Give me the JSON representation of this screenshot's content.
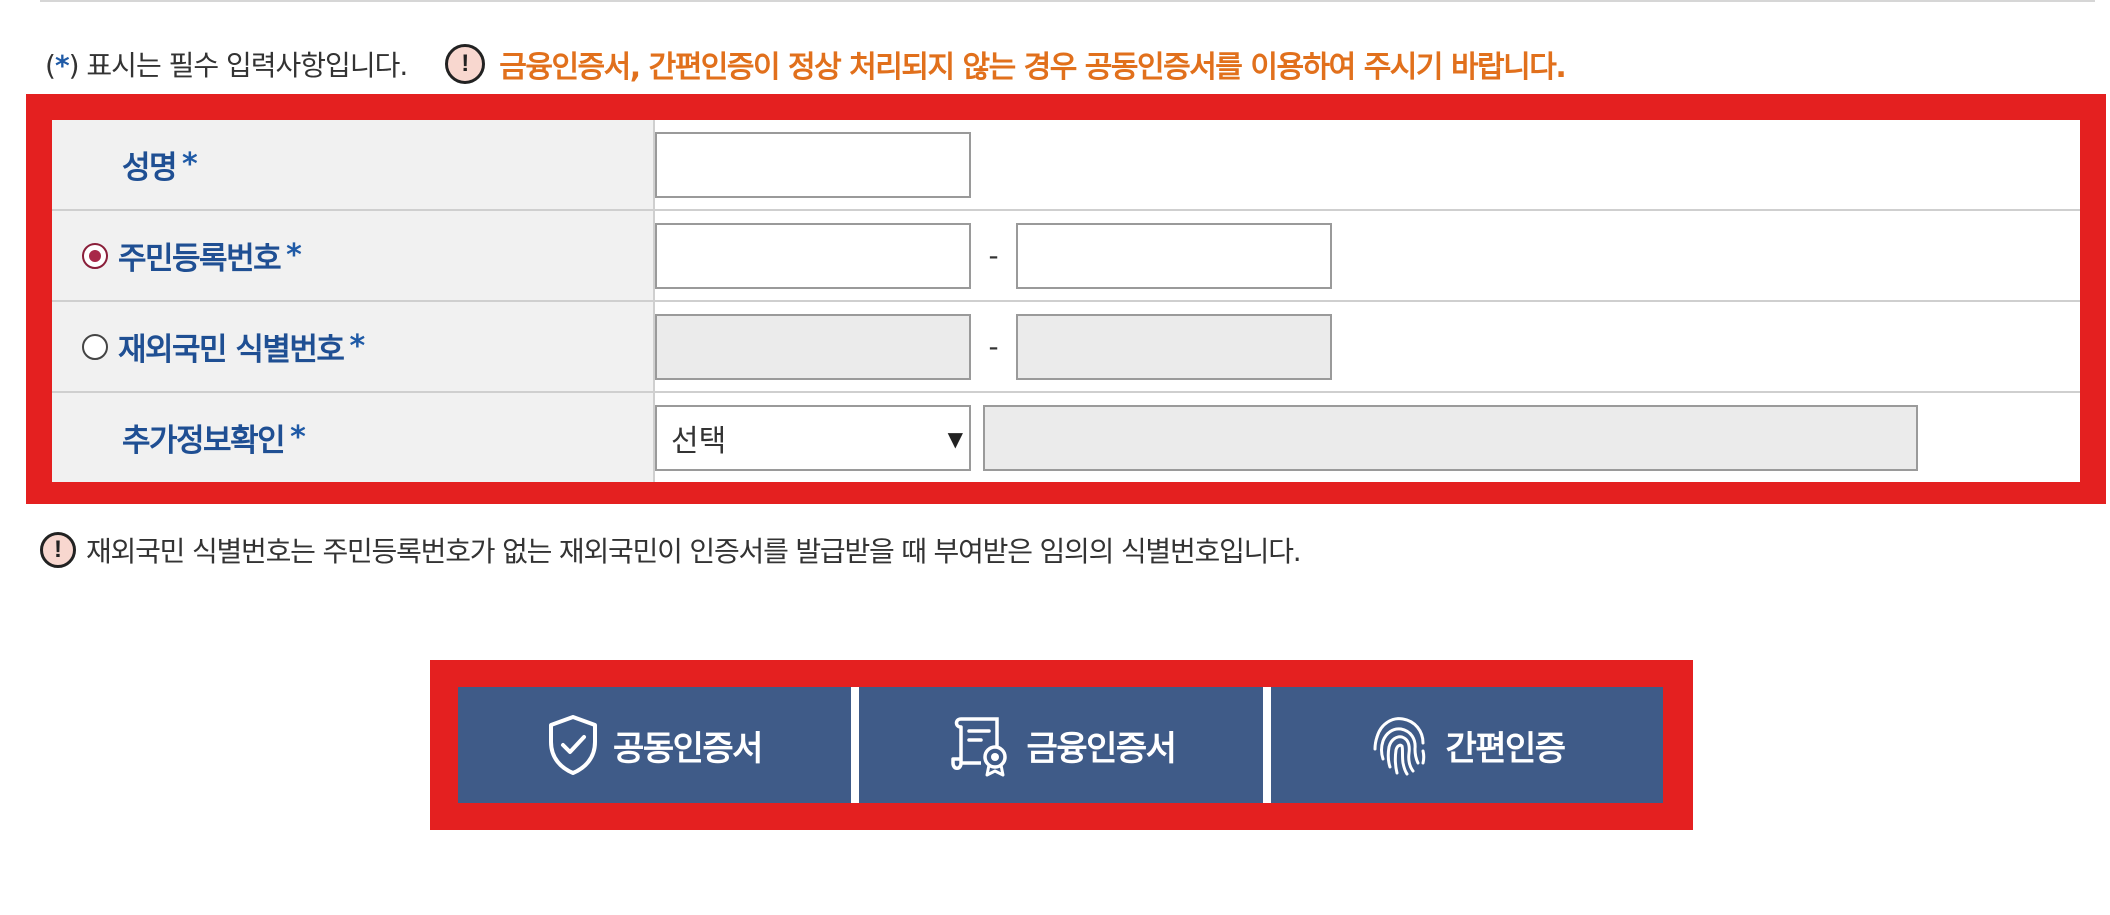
{
  "notice": {
    "required_prefix": "(",
    "required_star": "*",
    "required_suffix": ") 표시는 필수 입력사항입니다.",
    "warning": "금융인증서, 간편인증이 정상 처리되지 않는 경우 공동인증서를 이용하여 주시기 바랍니다."
  },
  "form": {
    "star": "*",
    "name_label": "성명",
    "resident_label": "주민등록번호",
    "resident_selected": true,
    "overseas_label": "재외국민 식별번호",
    "overseas_selected": false,
    "extra_label": "추가정보확인",
    "dash": "-",
    "extra_select_value": "선택",
    "select_arrow": "▼"
  },
  "info": {
    "text": "재외국민 식별번호는 주민등록번호가 없는 재외국민이 인증서를 발급받을 때 부여받은 임의의 식별번호입니다."
  },
  "auth_buttons": {
    "joint_cert": "공동인증서",
    "financial_cert": "금융인증서",
    "simple_auth": "간편인증"
  },
  "colors": {
    "highlight_red": "#e42020",
    "label_blue": "#1f4f93",
    "warning_orange": "#e1701c",
    "button_navy": "#3f5b88"
  },
  "icons": {
    "warning": "exclamation-circle",
    "joint_cert": "shield-check",
    "financial_cert": "certificate-ribbon",
    "simple_auth": "fingerprint"
  }
}
